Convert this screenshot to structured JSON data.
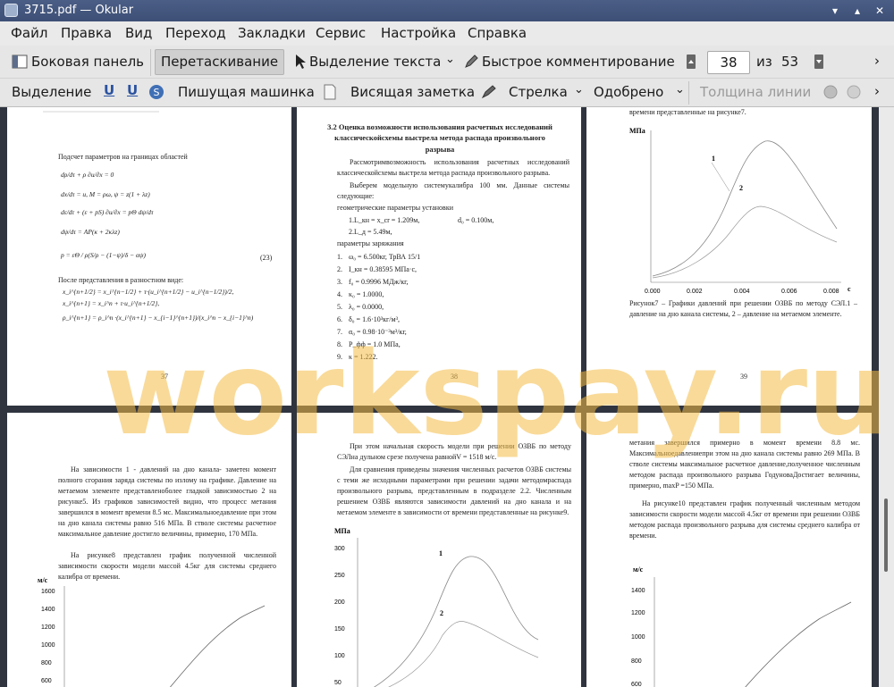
{
  "window": {
    "title": "3715.pdf — Okular"
  },
  "menu": [
    "Файл",
    "Правка",
    "Вид",
    "Переход",
    "Закладки",
    "Сервис",
    "Настройка",
    "Справка"
  ],
  "toolbar1": {
    "sidebar": "Боковая панель",
    "drag": "Перетаскивание",
    "text_select": "Выделение текста",
    "quick_comment": "Быстрое комментирование",
    "page_current": "38",
    "page_of": "из",
    "page_total": "53"
  },
  "toolbar2": {
    "highlight": "Выделение",
    "typewriter": "Пишущая машинка",
    "note": "Висящая заметка",
    "arrow": "Стрелка",
    "stamp": "Одобрено",
    "line_width": "Толщина линии"
  },
  "watermark": "workspay.ru",
  "colors": {
    "titlebar": "#4b5e86",
    "viewport": "#2f343f",
    "watermark": "#f4bc46"
  },
  "pages": {
    "p37": {
      "num": "37",
      "intro": "Подсчет параметров на границах областей",
      "eq1": "dρ/dτ + ρ ∂u/∂x = 0",
      "eq2": "dx/dτ = u,   M = ρω,   ψ = z(1 + λz)",
      "eq3": "dε/dτ + (ε + pS) ∂u/∂x = pΘ dψ/dτ",
      "eq4": "dψ/dτ = AP(κ + 2κλz)",
      "eq5": "p = εΘ / ρ(S/ρ − (1−ψ)/δ − αψ)",
      "eqnum": "(23)",
      "after": "После представления в разностном виде:",
      "diff1": "x_i^{n+1/2} = x_i^{n−1/2} + τ·(u_i^{n+1/2} − u_i^{n−1/2})/2,",
      "diff2": "x_i^{n+1} = x_i^n + τ·u_i^{n+1/2},",
      "diff3": "ρ_i^{n+1} = ρ_i^n ·(x_i^{n+1} − x_{i−1}^{n+1})/(x_i^n − x_{i−1}^n)"
    },
    "p38": {
      "num": "38",
      "heading": "3.2 Оценка возможности использования расчетных исследований классическойсхемы выстрела метода распада произвольного разрыва",
      "para1": "Рассмотримвозможность использования расчетных исследований классическойсхемы выстрела метода распада произвольного разрыва.",
      "para2": "Выберем модельную системукалибра 100 мм. Данные системы следующие:",
      "geo": "геометрические параметры установки",
      "g1": "1.L_кн = x_cr = 1.209м,",
      "g1b": "d₀ = 0.100м,",
      "g2": "2.L_д = 5.49м,",
      "charge": "параметры заряжания",
      "list": [
        "ω₀ = 6.500кг, ТрВА 15/1",
        "I_кн = 0.38595 МПа·с,",
        "f₀ = 0.9996 МДж/кг,",
        "κ₀ = 1.0000,",
        "λ₀ = 0.0000,",
        "δ₀ = 1.6·10³кг/м³,",
        "α₀ = 0.98·10⁻³м³/кг,",
        "P_фф = 1.0 МПа,",
        "κ = 1.222."
      ]
    },
    "p39": {
      "num": "39",
      "top": "времени представленные на рисунке7.",
      "ylabel": "МПа",
      "xunit": "с",
      "xticks": [
        "0.000",
        "0.002",
        "0.004",
        "0.006",
        "0.008"
      ],
      "caption": "Рисунок7 – Графики давлений при решении ОЗВБ по методу СЭЛ.1 – давление на дно канала системы, 2 – давление на метаемом элементе."
    },
    "p40": {
      "para1": "На зависимости 1 - давлений на дно канала- заметен момент полного сгорания заряда системы по излому на графике. Давление на метаемом элементе представленоболее гладкой зависимостью 2 на рисунке5. Из графиков зависимостей видно, что процесс метания завершился в момент времени 8.5 мс. Максимальноедавление при этом на дно канала системы равно 516 МПа. В стволе системы расчетное максимальное давление достигло величины, примерно, 170 МПа.",
      "para2": "На рисунке8 представлен график полученной численной зависимости скорости модели массой 4.5кг для системы среднего калибра от времени.",
      "ylabel": "м/с",
      "yticks": [
        "1600",
        "1400",
        "1200",
        "1000",
        "800",
        "600"
      ]
    },
    "p41": {
      "para1": "При этом начальная скорость модели при решении ОЗВБ по методу СЭЛна дульном срезе получена равнойV = 1518 м/с.",
      "para2": "Для сравнения приведены значения численных расчетов ОЗВБ системы с теми же исходными параметрами при решении задачи методомраспада произвольного разрыва, представленным в подразделе 2.2. Численным решением ОЗВБ являются зависимости давлений на дно канала и на метаемом элементе в зависимости от времени представленные на рисунке9.",
      "ylabel": "МПа",
      "yticks": [
        "300",
        "250",
        "200",
        "150",
        "100",
        "50"
      ]
    },
    "p42": {
      "para1": "метания завершился примерно в момент времени 8.8 мс. Максимальноедавлениепри этом на дно канала системы равно 269 МПа. В стволе системы максимальное расчетное давление,полученное численным методом распада произвольного разрыва ГодуноваДостигает величины, примерно, maxP =150 МПа.",
      "para2": "На рисунке10 представлен график полученный численным методом зависимости скорости модели массой 4.5кг от времени при решении ОЗВБ методом распада произвольного разрыва для системы среднего калибра от времени.",
      "ylabel": "м/с",
      "yticks": [
        "1400",
        "1200",
        "1000",
        "800",
        "600"
      ]
    }
  }
}
